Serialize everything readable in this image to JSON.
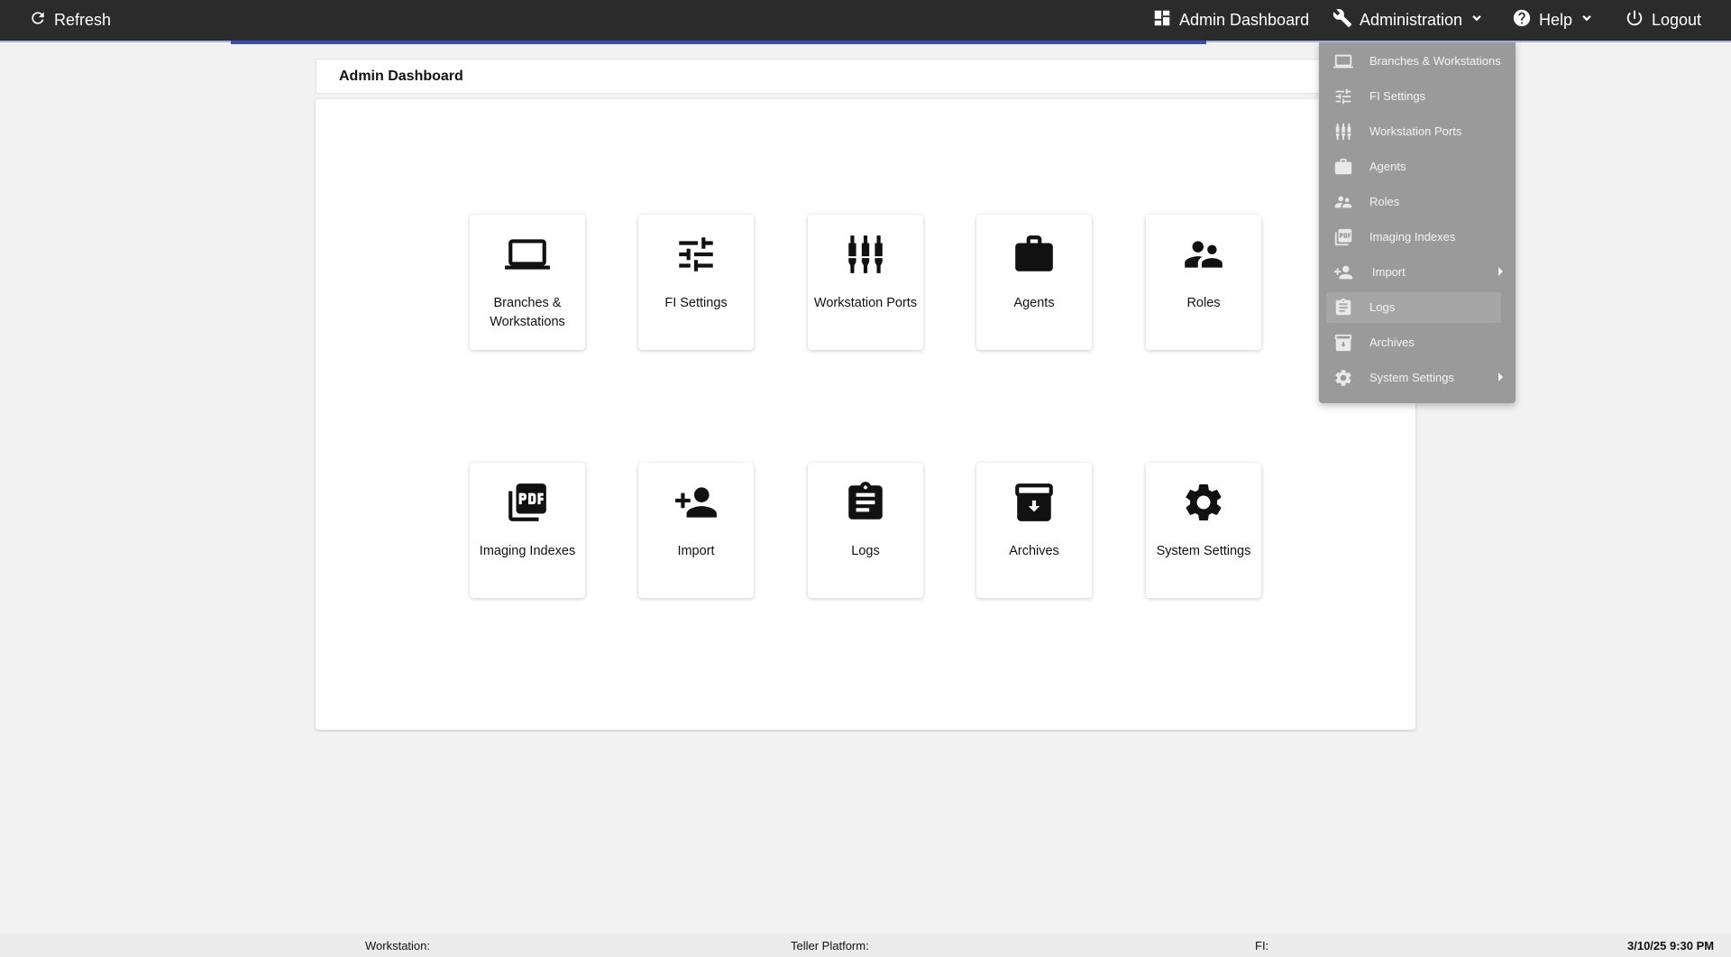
{
  "topbar": {
    "refresh_label": "Refresh",
    "admin_dashboard_label": "Admin Dashboard",
    "administration_label": "Administration",
    "help_label": "Help",
    "logout_label": "Logout"
  },
  "page": {
    "title": "Admin Dashboard"
  },
  "tiles": [
    {
      "label": "Branches & Workstations",
      "icon": "laptop-icon"
    },
    {
      "label": "FI Settings",
      "icon": "tune-icon"
    },
    {
      "label": "Workstation Ports",
      "icon": "ports-icon"
    },
    {
      "label": "Agents",
      "icon": "briefcase-icon"
    },
    {
      "label": "Roles",
      "icon": "people-icon"
    },
    {
      "label": "Imaging Indexes",
      "icon": "pdf-icon"
    },
    {
      "label": "Import",
      "icon": "person-add-icon"
    },
    {
      "label": "Logs",
      "icon": "clipboard-icon"
    },
    {
      "label": "Archives",
      "icon": "archive-icon"
    },
    {
      "label": "System Settings",
      "icon": "gear-icon"
    }
  ],
  "administration_menu": [
    {
      "label": "Branches & Workstations",
      "icon": "laptop-icon",
      "submenu": false
    },
    {
      "label": "FI Settings",
      "icon": "tune-icon",
      "submenu": false
    },
    {
      "label": "Workstation Ports",
      "icon": "ports-icon",
      "submenu": false
    },
    {
      "label": "Agents",
      "icon": "briefcase-icon",
      "submenu": false
    },
    {
      "label": "Roles",
      "icon": "people-icon",
      "submenu": false
    },
    {
      "label": "Imaging Indexes",
      "icon": "pdf-icon",
      "submenu": false
    },
    {
      "label": "Import",
      "icon": "person-add-icon",
      "submenu": true
    },
    {
      "label": "Logs",
      "icon": "clipboard-icon",
      "submenu": false
    },
    {
      "label": "Archives",
      "icon": "archive-icon",
      "submenu": false
    },
    {
      "label": "System Settings",
      "icon": "gear-icon",
      "submenu": true
    }
  ],
  "statusbar": {
    "workstation_label": "Workstation:",
    "teller_platform_label": "Teller Platform:",
    "fi_label": "FI:",
    "datetime": "3/10/25 9:30 PM"
  },
  "colors": {
    "topbar_bg": "#2b2b2b",
    "accent_progress": "#3a4fb0",
    "menu_bg": "#9a9a9a",
    "page_bg": "#f2f2f2"
  }
}
